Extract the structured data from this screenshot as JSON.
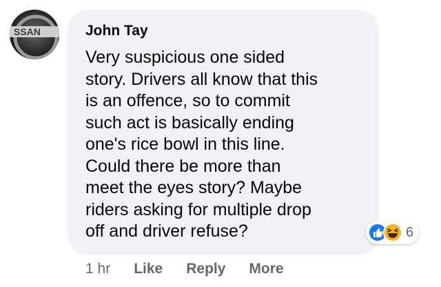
{
  "comment": {
    "avatar_text": "SSAN",
    "author": "John Tay",
    "text": "Very suspicious one sided\nstory. Drivers all know that this\nis an offence, so to commit\nsuch act is basically ending\none's rice bowl in this line.\nCould there be more than\nmeet the eyes story? Maybe\nriders asking for multiple drop\noff and driver refuse?",
    "reactions": {
      "icons": [
        "like-icon",
        "haha-icon"
      ],
      "count": "6"
    },
    "meta": {
      "timestamp": "1 hr",
      "like_label": "Like",
      "reply_label": "Reply",
      "more_label": "More"
    }
  },
  "colors": {
    "bubble_bg": "#f0f2f5",
    "text": "#050505",
    "meta_text": "#65676b",
    "like_blue": "#1877f2",
    "haha_yellow": "#f7b125"
  }
}
